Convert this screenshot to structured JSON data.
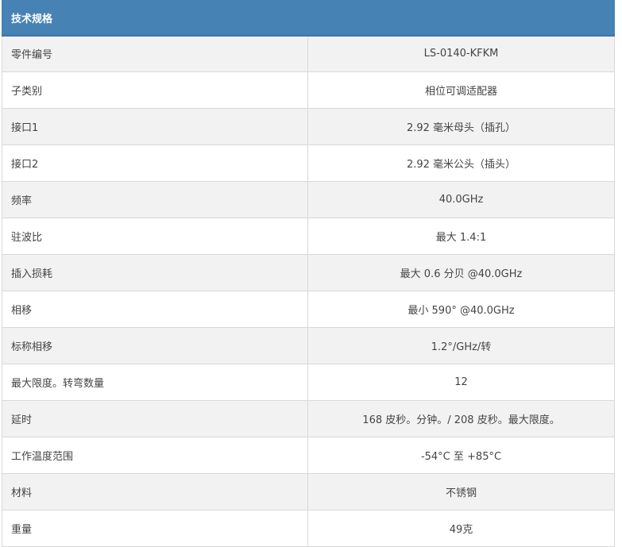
{
  "table": {
    "title": "技术规格",
    "rows": [
      {
        "label": "零件编号",
        "value": "LS-0140-KFKM"
      },
      {
        "label": "子类别",
        "value": "相位可调适配器"
      },
      {
        "label": "接口1",
        "value": "2.92 毫米母头（插孔）"
      },
      {
        "label": "接口2",
        "value": "2.92 毫米公头（插头）"
      },
      {
        "label": "频率",
        "value": "40.0GHz"
      },
      {
        "label": "驻波比",
        "value": "最大 1.4:1"
      },
      {
        "label": "插入损耗",
        "value": "最大 0.6 分贝 @40.0GHz"
      },
      {
        "label": "相移",
        "value": "最小 590° @40.0GHz"
      },
      {
        "label": "标称相移",
        "value": "1.2°/GHz/转"
      },
      {
        "label": "最大限度。转弯数量",
        "value": "12"
      },
      {
        "label": "延时",
        "value": "168 皮秒。分钟。/ 208 皮秒。最大限度。"
      },
      {
        "label": "工作温度范围",
        "value": "-54°C 至 +85°C"
      },
      {
        "label": "材料",
        "value": "不锈钢"
      },
      {
        "label": "重量",
        "value": "49克"
      }
    ]
  }
}
